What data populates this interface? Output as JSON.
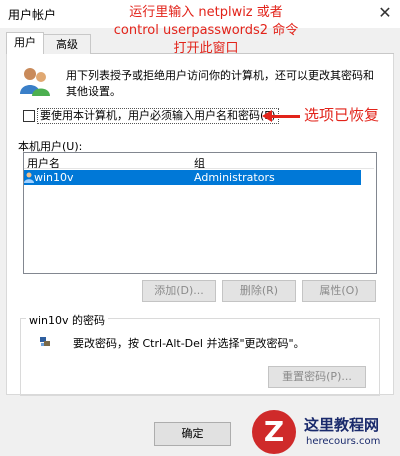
{
  "window": {
    "title": "用户帐户"
  },
  "tabs": [
    {
      "label": "用户",
      "active": true
    },
    {
      "label": "高级",
      "active": false
    }
  ],
  "intro_text": "用下列表授予或拒绝用户访问你的计算机，还可以更改其密码和其他设置。",
  "require_password_checkbox": {
    "label": "要使用本计算机，用户必须输入用户名和密码(E)",
    "checked": false
  },
  "local_users": {
    "label": "本机用户(U):",
    "columns": [
      "用户名",
      "组"
    ],
    "rows": [
      {
        "name": "win10v",
        "group": "Administrators",
        "selected": true
      }
    ]
  },
  "buttons": {
    "add": "添加(D)...",
    "remove": "删除(R)",
    "properties": "属性(O)",
    "reset_password": "重置密码(P)...",
    "ok": "确定"
  },
  "password_group": {
    "title": "win10v 的密码",
    "text": "要改密码，按 Ctrl-Alt-Del 并选择\"更改密码\"。"
  },
  "annotations": {
    "top_line1": "运行里输入 netplwiz 或者",
    "top_line2": "control userpasswords2 命令",
    "top_line3": "打开此窗口",
    "right": "选项已恢复",
    "color": "#e2231a"
  },
  "watermark": {
    "logo_letter": "Z",
    "name": "这里教程网",
    "url": "herecours.com"
  },
  "icons": [
    "users-icon",
    "user-row-icon",
    "key-icon",
    "close-icon"
  ]
}
